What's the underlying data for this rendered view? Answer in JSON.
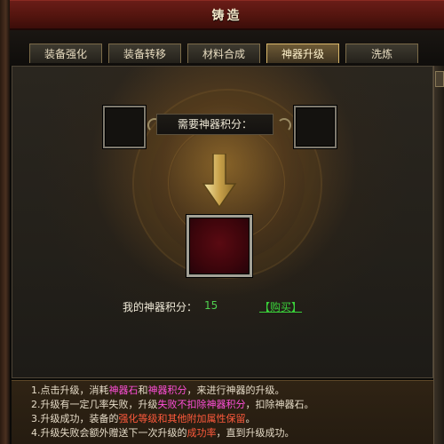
{
  "window": {
    "title": "铸造"
  },
  "tabs": [
    {
      "label": "装备强化"
    },
    {
      "label": "装备转移"
    },
    {
      "label": "材料合成"
    },
    {
      "label": "神器升级",
      "active": true
    },
    {
      "label": "洗炼"
    }
  ],
  "upgrade": {
    "required_label": "需要神器积分：",
    "my_score_label": "我的神器积分：",
    "my_score_value": "15",
    "buy_link": "【购买】"
  },
  "notes": [
    {
      "index": "1.",
      "parts": [
        "点击升级，消耗",
        "神器石",
        "和",
        "神器积分",
        "，来进行神器的升级。"
      ]
    },
    {
      "index": "2.",
      "parts": [
        "升级有一定几率失败，升级",
        "失败不扣除神器积分",
        "，扣除神器石。"
      ]
    },
    {
      "index": "3.",
      "parts": [
        "升级成功，装备的",
        "强化等级和其他附加属性保留",
        "。"
      ]
    },
    {
      "index": "4.",
      "parts": [
        "升级失败会额外赠送下一次升级的",
        "成功率",
        "，直到升级成功。"
      ]
    }
  ],
  "colors": {
    "header_bg": "#54150f",
    "highlight_pink": "#ff4fd8",
    "highlight_red": "#ff5a3c",
    "score_green": "#4fd04f"
  }
}
